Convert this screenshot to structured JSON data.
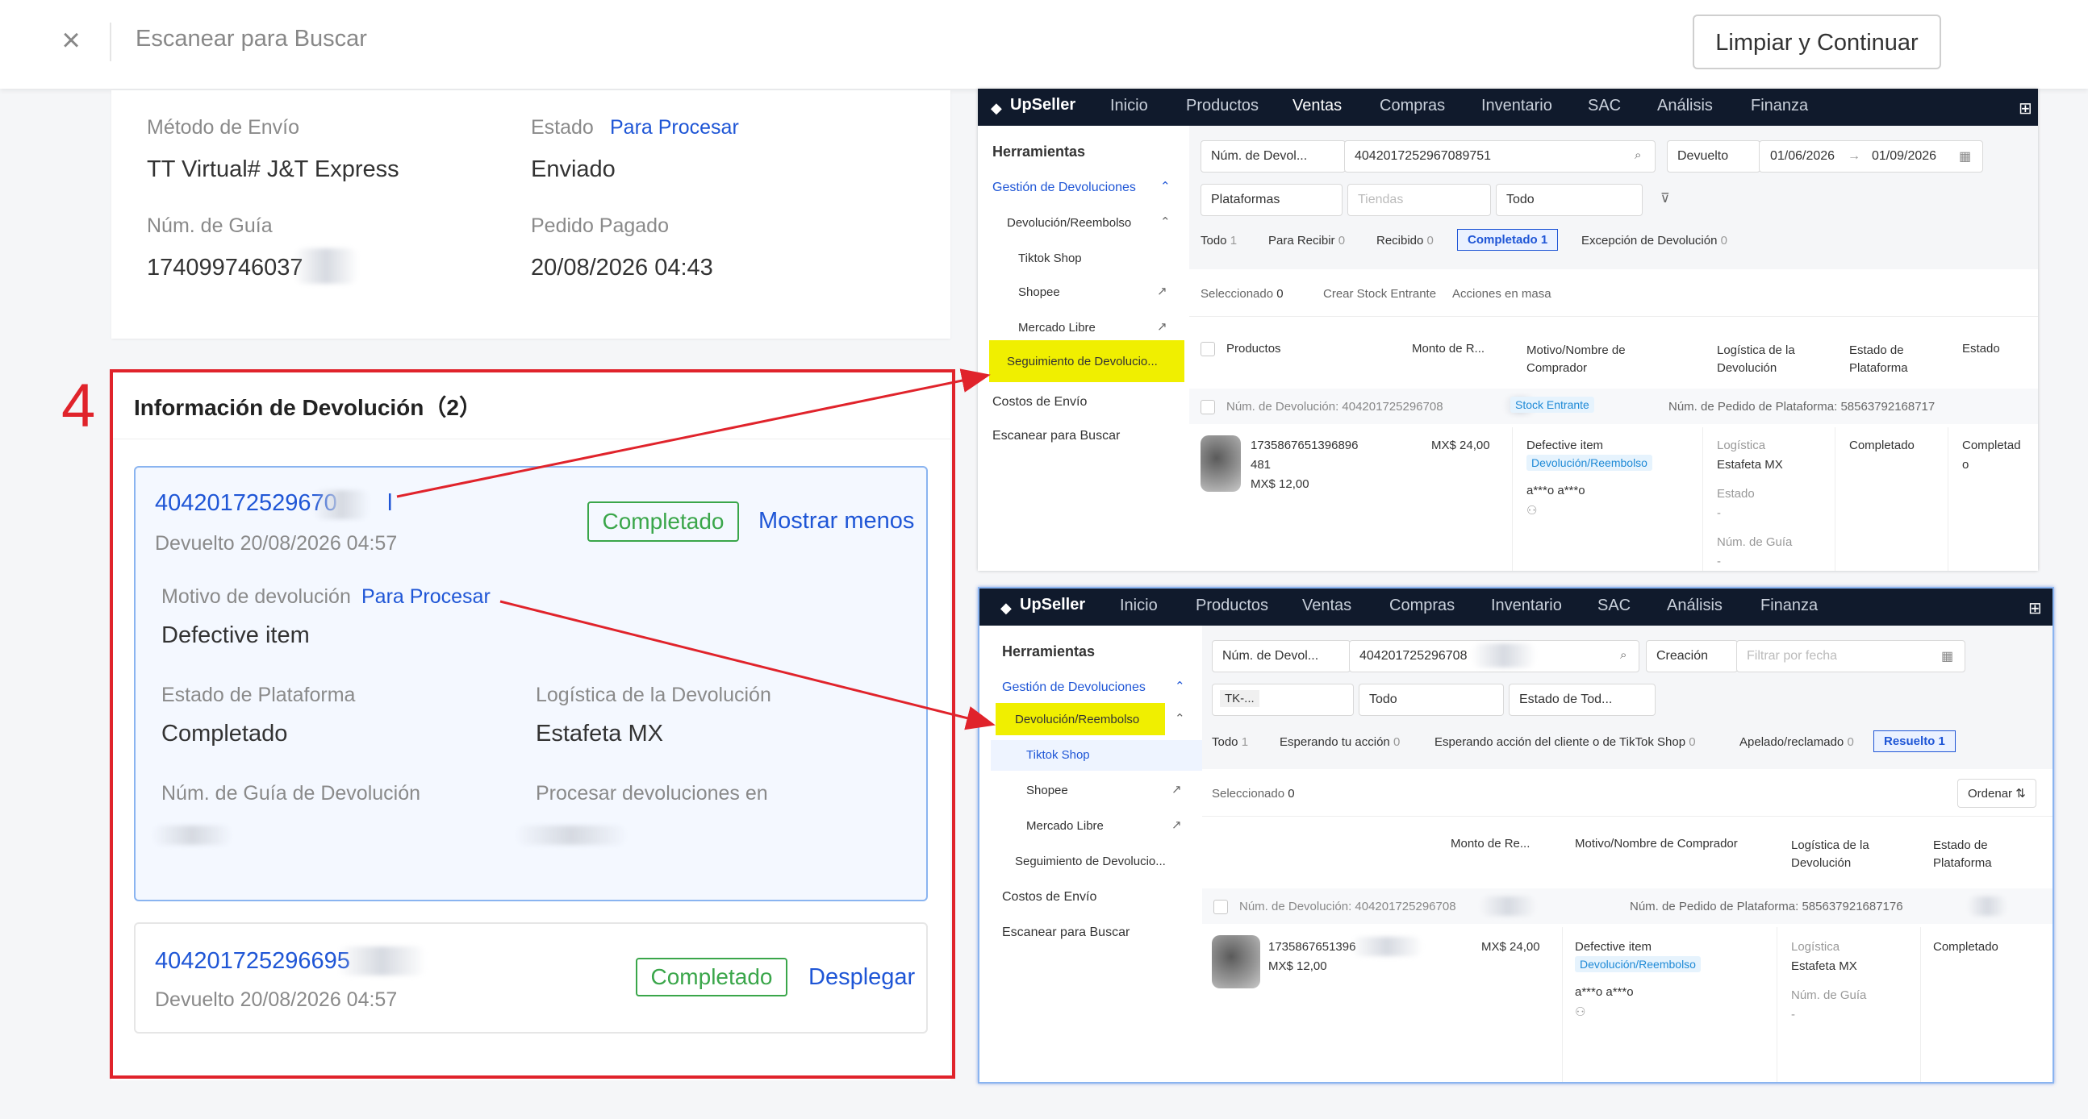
{
  "topbar": {
    "close_glyph": "×",
    "title": "Escanear para Buscar",
    "clear_button": "Limpiar y Continuar"
  },
  "order_card": {
    "shipping_method_label": "Método de Envío",
    "shipping_method_value": "TT Virtual# J&T Express",
    "status_label": "Estado",
    "status_link": "Para Procesar",
    "status_value": "Enviado",
    "tracking_label": "Núm. de Guía",
    "tracking_value": "174099746037",
    "paid_label": "Pedido Pagado",
    "paid_value": "20/08/2026 04:43"
  },
  "step_number": "4",
  "returns": {
    "title": "Información de Devolución（2）",
    "item1": {
      "id": "40420172529670",
      "id_tail": "l",
      "date": "Devuelto 20/08/2026 04:57",
      "status": "Completado",
      "toggle": "Mostrar menos",
      "reason_label": "Motivo de devolución",
      "reason_link": "Para Procesar",
      "reason_value": "Defective item",
      "platform_status_label": "Estado de Plataforma",
      "platform_status_value": "Completado",
      "logistics_label": "Logística de la Devolución",
      "logistics_value": "Estafeta MX",
      "return_guide_label": "Núm. de Guía de Devolución",
      "process_label": "Procesar devoluciones en"
    },
    "item2": {
      "id": "404201725296695",
      "date": "Devuelto 20/08/2026 04:57",
      "status": "Completado",
      "toggle": "Desplegar"
    }
  },
  "panel1": {
    "logo": "UpSeller",
    "nav": [
      "Inicio",
      "Productos",
      "Ventas",
      "Compras",
      "Inventario",
      "SAC",
      "Análisis",
      "Finanza"
    ],
    "sidebar": {
      "title": "Herramientas",
      "group": "Gestión de Devoluciones",
      "sub": "Devolución/Reembolso",
      "items": [
        "Tiktok Shop",
        "Shopee",
        "Mercado Libre"
      ],
      "tracking": "Seguimiento de Devolucio...",
      "shipping_costs": "Costos de Envío",
      "scan": "Escanear para Buscar"
    },
    "filters": {
      "search_type": "Núm. de Devol...",
      "search_value": "4042017252967089751",
      "date_type": "Devuelto",
      "date_from": "01/06/2026",
      "date_arrow": "→",
      "date_to": "01/09/2026",
      "platforms": "Plataformas",
      "stores_placeholder": "Tiendas",
      "all": "Todo"
    },
    "tabs": [
      {
        "label": "Todo",
        "count": "1"
      },
      {
        "label": "Para Recibir",
        "count": "0"
      },
      {
        "label": "Recibido",
        "count": "0"
      },
      {
        "label": "Completado",
        "count": "1"
      },
      {
        "label": "Excepción de Devolución",
        "count": "0"
      }
    ],
    "actions": {
      "selected": "Seleccionado",
      "selected_count": "0",
      "create_stock": "Crear Stock Entrante",
      "bulk": "Acciones en masa"
    },
    "columns": [
      "Productos",
      "Monto de R...",
      "Motivo/Nombre de Comprador",
      "Logística de la Devolución",
      "Estado de Plataforma",
      "Estado"
    ],
    "row_header": {
      "return_no": "Núm. de Devolución: 404201725296708",
      "stock_tag": "Stock Entrante",
      "platform_order": "Núm. de Pedido de Plataforma: 58563792168717"
    },
    "row": {
      "sku_line1": "1735867651396896",
      "sku_line2": "481",
      "price": "MX$ 12,00",
      "amount": "MX$ 24,00",
      "reason": "Defective item",
      "reason_tag": "Devolución/Reembolso",
      "buyer": "a***o a***o",
      "logistics_label": "Logística",
      "logistics_value": "Estafeta MX",
      "state_label": "Estado",
      "state_value": "-",
      "guide_label": "Núm. de Guía",
      "guide_value": "-",
      "platform_status": "Completado",
      "status_line1": "Completad",
      "status_line2": "o"
    }
  },
  "panel2": {
    "logo": "UpSeller",
    "nav": [
      "Inicio",
      "Productos",
      "Ventas",
      "Compras",
      "Inventario",
      "SAC",
      "Análisis",
      "Finanza"
    ],
    "sidebar": {
      "title": "Herramientas",
      "group": "Gestión de Devoluciones",
      "sub": "Devolución/Reembolso",
      "items": [
        "Tiktok Shop",
        "Shopee",
        "Mercado Libre"
      ],
      "tracking": "Seguimiento de Devolucio...",
      "shipping_costs": "Costos de Envío",
      "scan": "Escanear para Buscar"
    },
    "filters": {
      "search_type": "Núm. de Devol...",
      "search_value": "404201725296708",
      "date_type": "Creación",
      "date_placeholder": "Filtrar por fecha",
      "store_tag": "TK-...",
      "all": "Todo",
      "state": "Estado de Tod..."
    },
    "tabs": [
      {
        "label": "Todo",
        "count": "1"
      },
      {
        "label": "Esperando tu acción",
        "count": "0"
      },
      {
        "label": "Esperando acción del cliente o de TikTok Shop",
        "count": "0"
      },
      {
        "label": "Apelado/reclamado",
        "count": "0"
      },
      {
        "label": "Resuelto",
        "count": "1"
      }
    ],
    "actions": {
      "selected": "Seleccionado",
      "selected_count": "0",
      "sort": "Ordenar"
    },
    "columns": [
      "Monto de Re...",
      "Motivo/Nombre de Comprador",
      "Logística de la Devolución",
      "Estado de Plataforma"
    ],
    "row_header": {
      "return_no": "Núm. de Devolución: 404201725296708",
      "platform_order": "Núm. de Pedido de Plataforma: 585637921687176"
    },
    "row": {
      "sku": "1735867651396",
      "price": "MX$ 12,00",
      "amount": "MX$ 24,00",
      "reason": "Defective item",
      "reason_tag": "Devolución/Reembolso",
      "buyer": "a***o a***o",
      "logistics_label": "Logística",
      "logistics_value": "Estafeta MX",
      "guide_label": "Núm. de Guía",
      "guide_value": "-",
      "platform_status": "Completado"
    }
  },
  "colors": {
    "accent_blue": "#1f56d6",
    "green": "#3aa64a",
    "annotation_red": "#e0232b",
    "highlight_yellow": "#f0ef00",
    "navbar_dark": "#101a2c"
  }
}
